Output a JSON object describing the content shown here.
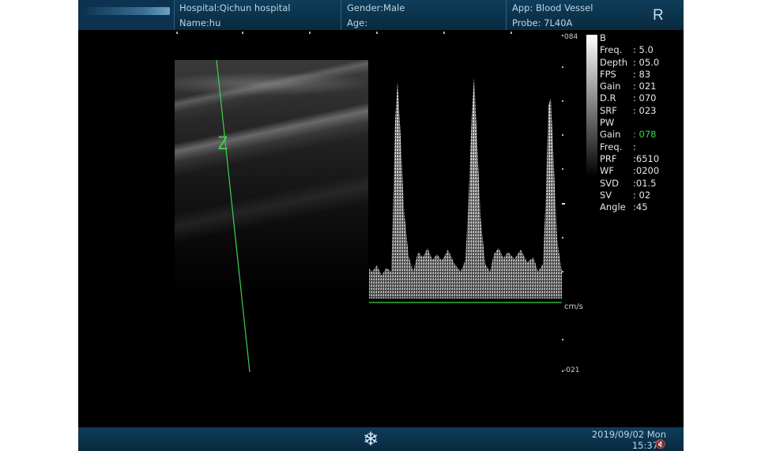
{
  "header": {
    "hospital": "Hospital:Qichun hospital",
    "name": "Name:hu",
    "gender": "Gender:Male",
    "age": "Age:",
    "app": "App: Blood Vessel",
    "probe": "Probe: 7L40A",
    "orientation": "R"
  },
  "params": {
    "b_title": "B",
    "b": [
      {
        "k": "Freq.",
        "v": ": 5.0"
      },
      {
        "k": "Depth",
        "v": ": 05.0"
      },
      {
        "k": "FPS",
        "v": ": 83"
      },
      {
        "k": "Gain",
        "v": ": 021"
      },
      {
        "k": "D.R",
        "v": ": 070"
      },
      {
        "k": "SRF",
        "v": ": 023"
      }
    ],
    "pw_title": "PW",
    "pw": [
      {
        "k": "Gain",
        "v": ": 078"
      },
      {
        "k": "Freq.",
        "v": ":"
      },
      {
        "k": "PRF",
        "v": ":6510"
      },
      {
        "k": "WF",
        "v": ":0200"
      },
      {
        "k": "SVD",
        "v": ":01.5"
      },
      {
        "k": "SV",
        "v": ": 02"
      },
      {
        "k": "Angle",
        "v": ":45"
      }
    ]
  },
  "scale": {
    "top": "084",
    "unit": "cm/s",
    "bottom": "-021"
  },
  "sample_marker": "Z",
  "footer": {
    "date": "2019/09/02 Mon",
    "time": "15:37",
    "freeze_icon": "snowflake-icon",
    "speaker_icon": "speaker-muted-icon"
  },
  "colors": {
    "header_bg": "#0f3d5a",
    "doppler_line": "#39d44a",
    "highlight": "#39d44a"
  }
}
